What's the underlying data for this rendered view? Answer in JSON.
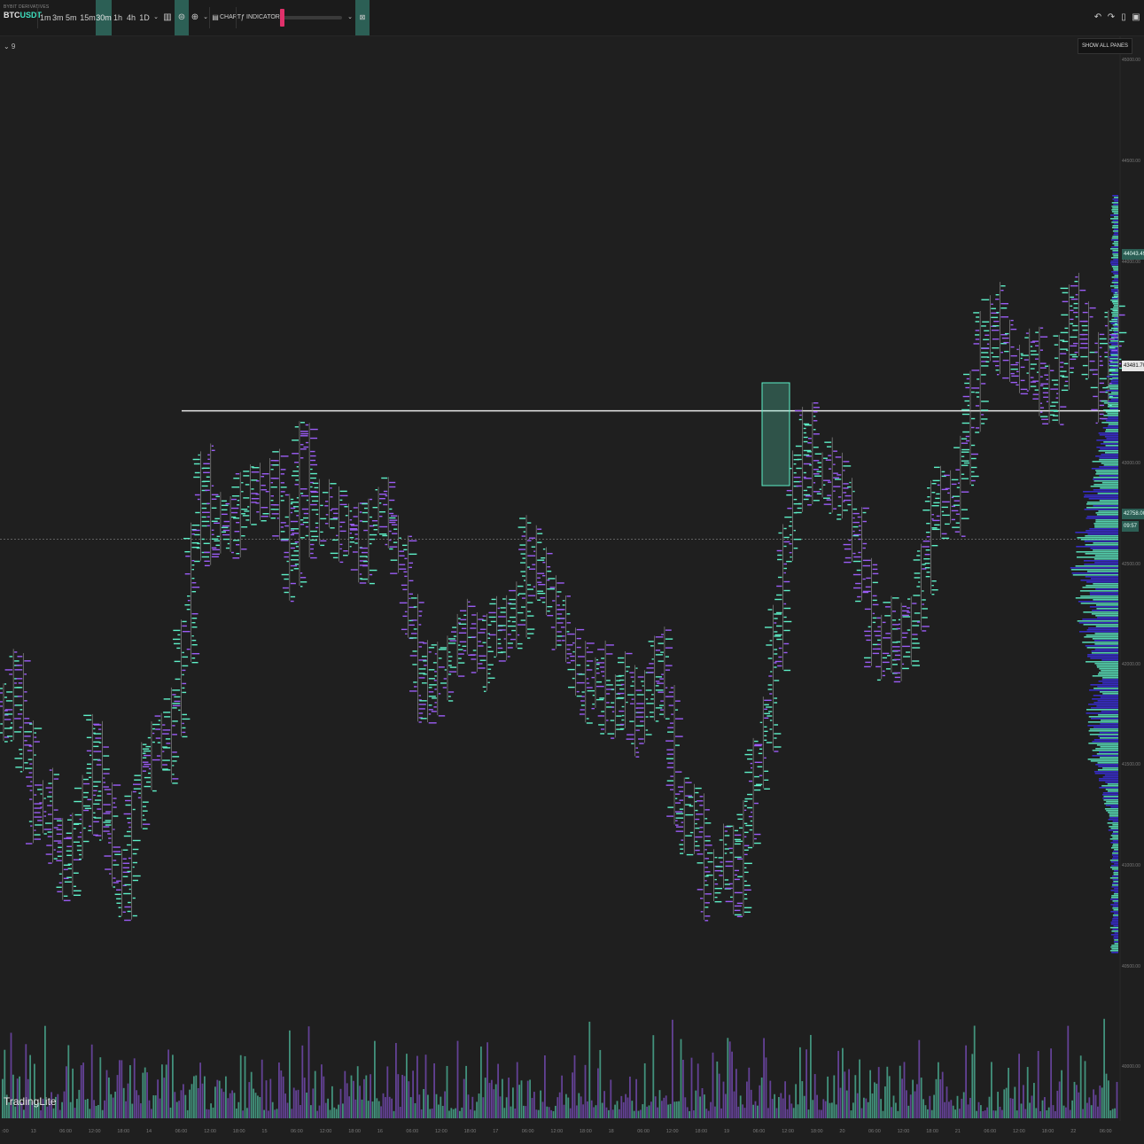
{
  "toolbar": {
    "exchange": "BYBIT DERIVATIVES",
    "pair_base": "BTC",
    "pair_quote": "USDT",
    "timeframes": [
      "1m",
      "3m",
      "5m",
      "15m",
      "30m",
      "1h",
      "4h",
      "1D"
    ],
    "active_timeframe": "30m",
    "chart_label": "CHART",
    "indicators_label": "INDICATORS",
    "icons": [
      "chevron-down-icon",
      "bars-icon",
      "layout-icon",
      "align-icon",
      "chart-icon",
      "indicators-icon",
      "close-icon",
      "undo-icon",
      "redo-icon",
      "window-icon",
      "camera-icon"
    ]
  },
  "overlay": {
    "show_all_panes": "SHOW ALL PANES",
    "legend_toggle": "⌄ 9"
  },
  "brand": {
    "logo_text": "TradingLite"
  },
  "price_axis": {
    "labels": [
      "45000.00",
      "44500.00",
      "44000.00",
      "43000.00",
      "42500.00",
      "42000.00",
      "41500.00",
      "41000.00",
      "40500.00",
      "40000.00"
    ],
    "tags": [
      {
        "text": "44043.49",
        "color": "#3fe0c0"
      },
      {
        "text": "43481.70",
        "color": "#e6e6e6"
      },
      {
        "text": "42758.00",
        "color": "#3fe0c0"
      },
      {
        "text": "09:57",
        "color": "#3fe0c0"
      }
    ]
  },
  "time_axis": {
    "labels": [
      ":00",
      "13",
      "06:00",
      "12:00",
      "18:00",
      "14",
      "06:00",
      "12:00",
      "18:00",
      "15",
      "06:00",
      "12:00",
      "18:00",
      "16",
      "06:00",
      "12:00",
      "18:00",
      "17",
      "06:00",
      "12:00",
      "18:00",
      "18",
      "06:00",
      "12:00",
      "18:00",
      "19",
      "06:00",
      "12:00",
      "18:00",
      "20",
      "06:00",
      "12:00",
      "18:00",
      "21",
      "06:00",
      "12:00",
      "18:00",
      "22",
      "06:00"
    ]
  },
  "colors": {
    "bg": "#1f1f1f",
    "buy": "#5ef0c8",
    "sell": "#9b5cf5",
    "accent": "#2c5f55"
  },
  "chart_data": {
    "type": "line",
    "series": [
      {
        "values": [
          41800,
          41950,
          41600,
          41200,
          41300,
          41050,
          40850,
          41100,
          41250,
          41600,
          41250,
          40900,
          40750,
          41250,
          41450,
          41600,
          41550,
          41800,
          42200,
          42750,
          43150,
          42800,
          42850,
          42800,
          42950,
          43050,
          43000,
          43100,
          42900,
          42600,
          43250,
          42850,
          43000,
          42950,
          42800,
          42850,
          42650,
          42900,
          42950,
          42800,
          42650,
          42300,
          41850,
          42000,
          41950,
          42100,
          42250,
          42200,
          42100,
          42200,
          42300,
          42250,
          42350,
          42700,
          42550,
          42450,
          42250,
          42150,
          42000,
          41900,
          42000,
          41800,
          41850,
          41950,
          41700,
          41900,
          42100,
          41850,
          41300,
          41150,
          41200,
          40800,
          40900,
          41000,
          40750,
          41150,
          41450,
          41750,
          42200,
          42750,
          43100,
          43350,
          43100,
          43150,
          43050,
          43000,
          42800,
          42550,
          42200,
          42150,
          42250,
          42150,
          42350,
          42550,
          42900,
          43050,
          42950,
          43200,
          43550,
          43900,
          44050,
          43850,
          43750,
          43700,
          43850,
          43650,
          43500,
          43750,
          44100,
          43900,
          43800,
          43600,
          43900,
          44043
        ]
      }
    ],
    "hline": 43481.7,
    "current_price": 42758.0,
    "ylim": [
      40300,
      45500
    ],
    "volume_profile": true
  }
}
